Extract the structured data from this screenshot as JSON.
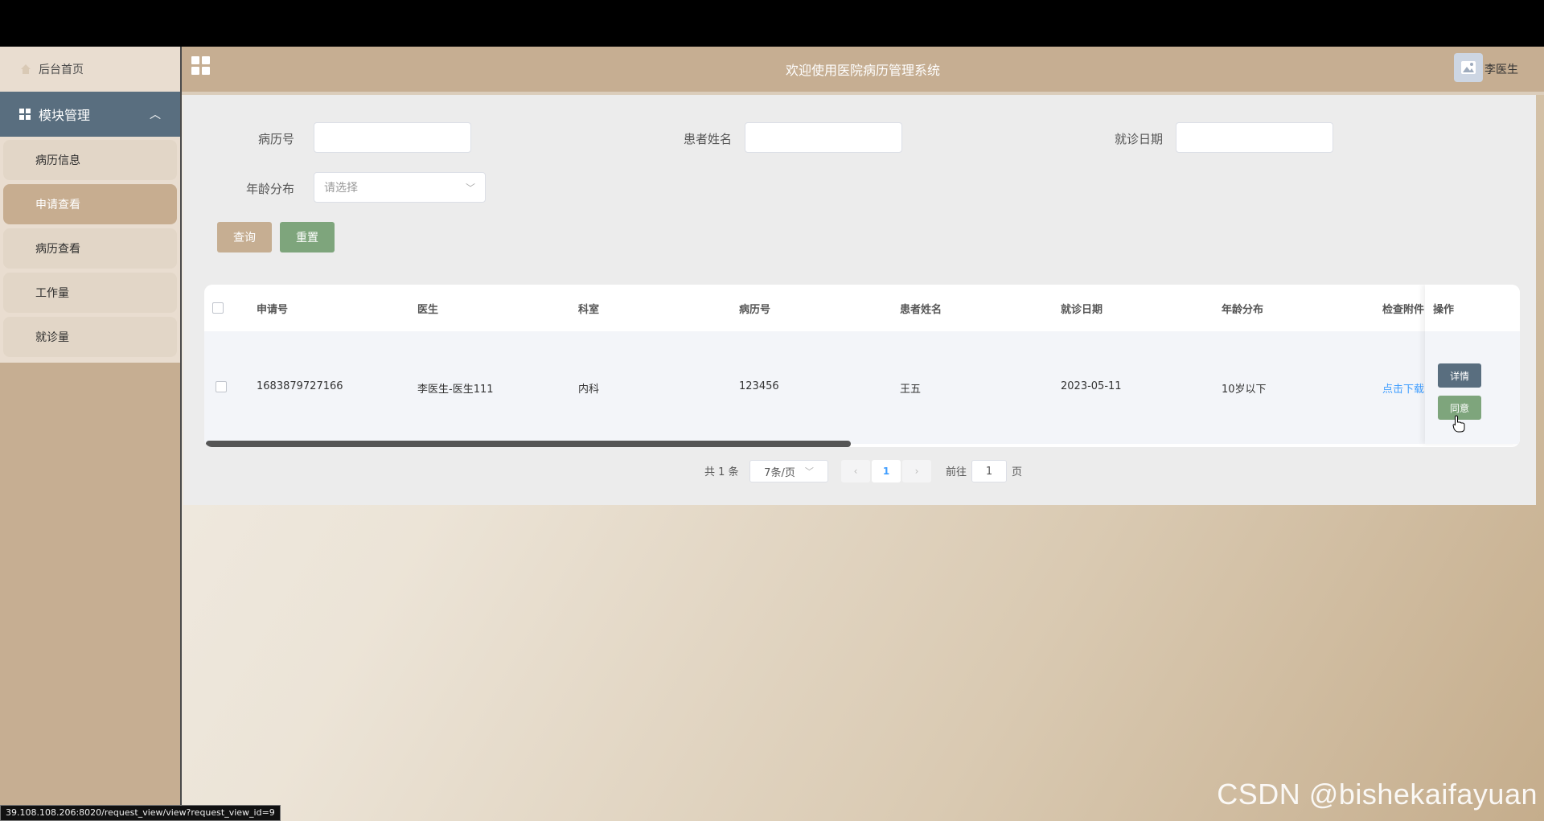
{
  "header": {
    "title": "欢迎使用医院病历管理系统",
    "user_name": "李医生"
  },
  "sidebar": {
    "home_label": "后台首页",
    "module_label": "模块管理",
    "items": [
      {
        "label": "病历信息",
        "active": false
      },
      {
        "label": "申请查看",
        "active": true
      },
      {
        "label": "病历查看",
        "active": false
      },
      {
        "label": "工作量",
        "active": false
      },
      {
        "label": "就诊量",
        "active": false
      }
    ]
  },
  "search": {
    "record_no_label": "病历号",
    "record_no_value": "",
    "patient_name_label": "患者姓名",
    "patient_name_value": "",
    "visit_date_label": "就诊日期",
    "visit_date_value": "",
    "age_label": "年龄分布",
    "age_placeholder": "请选择",
    "query_button": "查询",
    "reset_button": "重置"
  },
  "table": {
    "columns": [
      "申请号",
      "医生",
      "科室",
      "病历号",
      "患者姓名",
      "就诊日期",
      "年龄分布",
      "检查附件",
      "操作"
    ],
    "rows": [
      {
        "request_no": "1683879727166",
        "doctor": "李医生-医生111",
        "department": "内科",
        "record_no": "123456",
        "patient_name": "王五",
        "visit_date": "2023-05-11",
        "age_group": "10岁以下",
        "attachment": "点击下载",
        "detail_button": "详情",
        "agree_button": "同意"
      }
    ]
  },
  "pagination": {
    "total": "共 1 条",
    "page_size": "7条/页",
    "current_page": "1",
    "goto_label": "前往",
    "goto_value": "1",
    "page_suffix": "页"
  },
  "status_url": "39.108.108.206:8020/request_view/view?request_view_id=9",
  "watermark": "CSDN @bishekaifayuan"
}
